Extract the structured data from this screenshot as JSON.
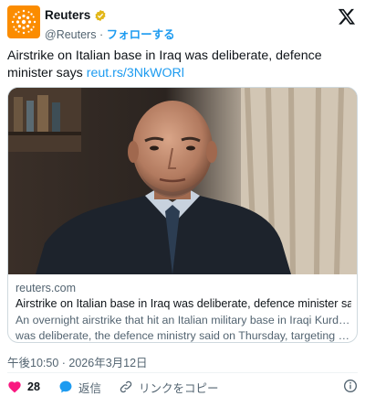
{
  "account": {
    "name": "Reuters",
    "handle": "@Reuters",
    "separator": " · ",
    "follow_label": "フォローする"
  },
  "tweet": {
    "text": "Airstrike on Italian base in Iraq was deliberate, defence minister says ",
    "link": "reut.rs/3NkWORl"
  },
  "card": {
    "domain": "reuters.com",
    "title": "Airstrike on Italian base in Iraq was deliberate, defence minister says",
    "description_line1": "An overnight airstrike that hit an Italian military base in Iraqi Kurdistan",
    "description_line2": "was deliberate, the defence ministry said on Thursday, targeting a facility..."
  },
  "timestamp": "午後10:50 · 2026年3月12日",
  "actions": {
    "like_count": "28",
    "reply_label": "返信",
    "copy_link_label": "リンクをコピー"
  },
  "colors": {
    "accent": "#1d9bf0",
    "like": "#f91880",
    "brand": "#fb8c00"
  },
  "icons": [
    "reuters-logo-icon",
    "verified-badge-icon",
    "x-logo-icon",
    "heart-icon",
    "reply-icon",
    "link-icon",
    "info-icon"
  ]
}
